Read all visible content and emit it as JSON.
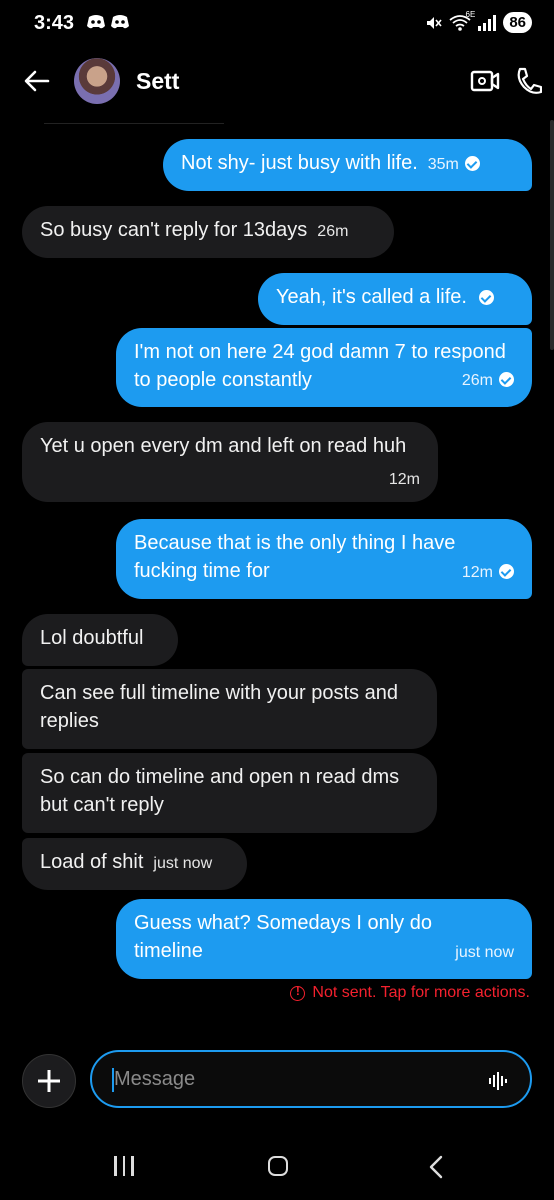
{
  "status_bar": {
    "time": "3:43",
    "network_label": "6E",
    "battery": "86"
  },
  "header": {
    "contact_name": "Sett"
  },
  "messages": [
    {
      "text": "Not shy- just busy with life.",
      "time": "35m",
      "sender": "me"
    },
    {
      "text": "So busy can't reply for 13days",
      "time": "26m",
      "sender": "them"
    },
    {
      "text": "Yeah, it's called a life.",
      "time": "",
      "sender": "me"
    },
    {
      "text": "I'm not on here 24 god damn 7 to respond to people constantly",
      "time": "26m",
      "sender": "me"
    },
    {
      "text": "Yet u open every dm and left on read huh",
      "time": "12m",
      "sender": "them"
    },
    {
      "text": "Because that is the only thing I have fucking time for",
      "time": "12m",
      "sender": "me"
    },
    {
      "text": "Lol doubtful",
      "time": "",
      "sender": "them"
    },
    {
      "text": "Can see full timeline with your posts and replies",
      "time": "",
      "sender": "them"
    },
    {
      "text": "So can do timeline and open n read dms but can't reply",
      "time": "",
      "sender": "them"
    },
    {
      "text": "Load of shit",
      "time": "just now",
      "sender": "them"
    },
    {
      "text": "Guess what? Somedays I only do timeline",
      "time": "just now",
      "sender": "me"
    }
  ],
  "error_text": "Not sent. Tap for more actions.",
  "composer": {
    "placeholder": "Message"
  },
  "colors": {
    "accent": "#1d9bf0",
    "incoming_bubble": "#1c1c1e",
    "error": "#f4212e"
  }
}
